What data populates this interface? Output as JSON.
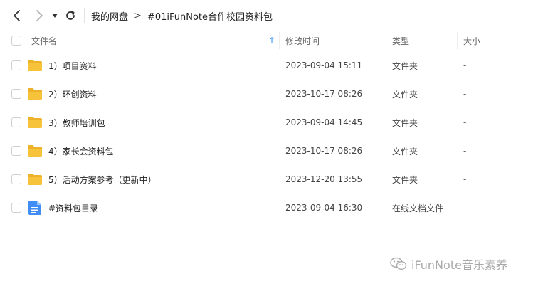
{
  "breadcrumb": {
    "items": [
      "我的网盘",
      "#01iFunNote合作校园资料包"
    ],
    "separator": ">"
  },
  "table": {
    "columns": {
      "name": "文件名",
      "modified": "修改时间",
      "type": "类型",
      "size": "大小"
    },
    "sort_indicator": "↑",
    "rows": [
      {
        "icon": "folder-icon",
        "name": "1）项目资料",
        "modified": "2023-09-04 15:11",
        "type": "文件夹",
        "size": "-"
      },
      {
        "icon": "folder-icon",
        "name": "2）环创资料",
        "modified": "2023-10-17 08:26",
        "type": "文件夹",
        "size": "-"
      },
      {
        "icon": "folder-icon",
        "name": "3）教师培训包",
        "modified": "2023-09-04 14:45",
        "type": "文件夹",
        "size": "-"
      },
      {
        "icon": "folder-icon",
        "name": "4）家长会资料包",
        "modified": "2023-10-17 08:26",
        "type": "文件夹",
        "size": "-"
      },
      {
        "icon": "folder-icon",
        "name": "5）活动方案参考（更新中）",
        "modified": "2023-12-20 13:55",
        "type": "文件夹",
        "size": "-"
      },
      {
        "icon": "online-doc-icon",
        "name": "#资料包目录",
        "modified": "2023-09-04 16:30",
        "type": "在线文档文件",
        "size": "-"
      }
    ]
  },
  "watermark": {
    "text": "iFunNote音乐素养",
    "icon": "wechat-icon"
  },
  "colors": {
    "folder": "#f7c33b",
    "folder_dark": "#eeb22a",
    "doc": "#3f8df5",
    "accent": "#2f86f6"
  }
}
